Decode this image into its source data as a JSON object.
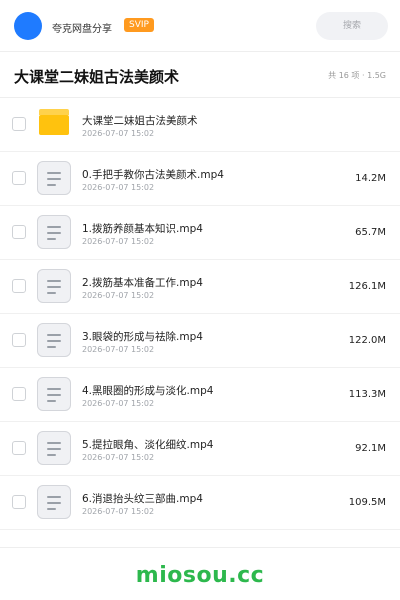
{
  "header": {
    "share_name": "夸克网盘分享",
    "badge": "SVIP",
    "search_placeholder": "搜索"
  },
  "folder": {
    "title": "大课堂二妹姐古法美颜术",
    "summary": "共 16 项 · 1.5G"
  },
  "items": [
    {
      "type": "folder",
      "name": "大课堂二妹姐古法美颜术",
      "date": "2026-07-07 15:02",
      "size": ""
    },
    {
      "type": "file",
      "name": "0.手把手教你古法美颜术.mp4",
      "date": "2026-07-07 15:02",
      "size": "14.2M"
    },
    {
      "type": "file",
      "name": "1.拨筋养颜基本知识.mp4",
      "date": "2026-07-07 15:02",
      "size": "65.7M"
    },
    {
      "type": "file",
      "name": "2.拨筋基本准备工作.mp4",
      "date": "2026-07-07 15:02",
      "size": "126.1M"
    },
    {
      "type": "file",
      "name": "3.眼袋的形成与祛除.mp4",
      "date": "2026-07-07 15:02",
      "size": "122.0M"
    },
    {
      "type": "file",
      "name": "4.黑眼圈的形成与淡化.mp4",
      "date": "2026-07-07 15:02",
      "size": "113.3M"
    },
    {
      "type": "file",
      "name": "5.提拉眼角、淡化细纹.mp4",
      "date": "2026-07-07 15:02",
      "size": "92.1M"
    },
    {
      "type": "file",
      "name": "6.消退抬头纹三部曲.mp4",
      "date": "2026-07-07 15:02",
      "size": "109.5M"
    }
  ],
  "watermark": "miosou.cc",
  "colors": {
    "avatar": "#1f7bff",
    "badge": "#ff9a1f",
    "folder_icon": "#ffc20e",
    "watermark": "#2db84d"
  }
}
